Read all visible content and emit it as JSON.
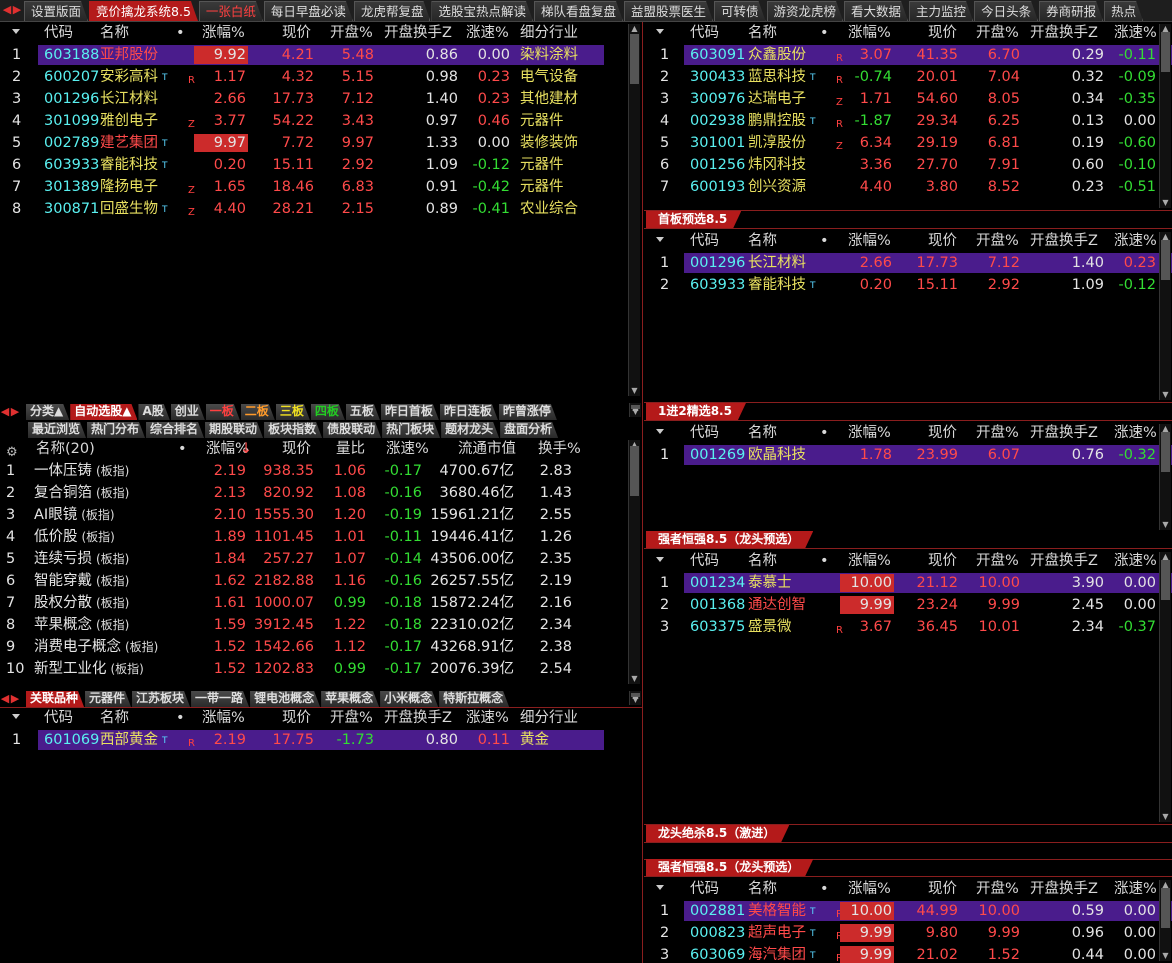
{
  "top_tabs": [
    "设置版面",
    "竞价擒龙系统8.5",
    "一张白纸",
    "每日早盘必读",
    "龙虎帮复盘",
    "选股宝热点解读",
    "梯队看盘复盘",
    "益盟股票医生",
    "可转债",
    "游资龙虎榜",
    "看大数据",
    "主力监控",
    "今日头条",
    "券商研报",
    "热点"
  ],
  "nav_arrows": [
    "◀",
    "▶"
  ],
  "stock_headers": [
    "代码",
    "名称",
    "•",
    "涨幅%",
    "现价",
    "开盘%",
    "开盘换手Z",
    "涨速%",
    "细分行业"
  ],
  "short_headers": [
    "代码",
    "名称",
    "•",
    "涨幅%",
    "现价",
    "开盘%",
    "开盘换手Z",
    "涨速%"
  ],
  "panel1": {
    "rows": [
      {
        "n": "1",
        "code": "603188",
        "name": "亚邦股份",
        "t": "",
        "b": "",
        "chg": "9.92",
        "price": "4.21",
        "open": "5.48",
        "turn": "0.86",
        "spd": "0.00",
        "ind": "染料涂料",
        "sel": true,
        "hl": true,
        "namecolor": "r"
      },
      {
        "n": "2",
        "code": "600207",
        "name": "安彩高科",
        "t": "T",
        "b": "R",
        "chg": "1.17",
        "price": "4.32",
        "open": "5.15",
        "turn": "0.98",
        "spd": "0.23",
        "ind": "电气设备"
      },
      {
        "n": "3",
        "code": "001296",
        "name": "长江材料",
        "t": "",
        "b": "",
        "chg": "2.66",
        "price": "17.73",
        "open": "7.12",
        "turn": "1.40",
        "spd": "0.23",
        "ind": "其他建材"
      },
      {
        "n": "4",
        "code": "301099",
        "name": "雅创电子",
        "t": "",
        "b": "Z",
        "chg": "3.77",
        "price": "54.22",
        "open": "3.43",
        "turn": "0.97",
        "spd": "0.46",
        "ind": "元器件"
      },
      {
        "n": "5",
        "code": "002789",
        "name": "建艺集团",
        "t": "T",
        "b": "",
        "chg": "9.97",
        "price": "7.72",
        "open": "9.97",
        "turn": "1.33",
        "spd": "0.00",
        "ind": "装修装饰",
        "hl": true,
        "namecolor": "r"
      },
      {
        "n": "6",
        "code": "603933",
        "name": "睿能科技",
        "t": "T",
        "b": "",
        "chg": "0.20",
        "price": "15.11",
        "open": "2.92",
        "turn": "1.09",
        "spd": "-0.12",
        "ind": "元器件"
      },
      {
        "n": "7",
        "code": "301389",
        "name": "隆扬电子",
        "t": "",
        "b": "Z",
        "chg": "1.65",
        "price": "18.46",
        "open": "6.83",
        "turn": "0.91",
        "spd": "-0.42",
        "ind": "元器件"
      },
      {
        "n": "8",
        "code": "300871",
        "name": "回盛生物",
        "t": "T",
        "b": "Z",
        "chg": "4.40",
        "price": "28.21",
        "open": "2.15",
        "turn": "0.89",
        "spd": "-0.41",
        "ind": "农业综合"
      }
    ]
  },
  "mid_tabs1": [
    "分类▲",
    "自动选股▲",
    "A股",
    "创业",
    "一板",
    "二板",
    "三板",
    "四板",
    "五板",
    "昨日首板",
    "昨日连板",
    "昨曾涨停"
  ],
  "mid_tabs2": [
    "最近浏览",
    "热门分布",
    "综合排名",
    "期股联动",
    "板块指数",
    "债股联动",
    "热门板块",
    "题材龙头",
    "盘面分析"
  ],
  "sector_headers": [
    "名称(20)",
    "•",
    "涨幅%",
    "现价",
    "量比",
    "涨速%",
    "流通市值",
    "换手%"
  ],
  "sector_sort_arrow": "↓",
  "sectors": [
    {
      "n": "1",
      "name": "一体压铸",
      "tag": "(板指)",
      "chg": "2.19",
      "price": "938.35",
      "vr": "1.06",
      "spd": "-0.17",
      "cap": "4700.67亿",
      "turn": "2.83"
    },
    {
      "n": "2",
      "name": "复合铜箔",
      "tag": "(板指)",
      "chg": "2.13",
      "price": "820.92",
      "vr": "1.08",
      "spd": "-0.16",
      "cap": "3680.46亿",
      "turn": "1.43"
    },
    {
      "n": "3",
      "name": "AI眼镜",
      "tag": "(板指)",
      "chg": "2.10",
      "price": "1555.30",
      "vr": "1.20",
      "spd": "-0.19",
      "cap": "15961.21亿",
      "turn": "2.55"
    },
    {
      "n": "4",
      "name": "低价股",
      "tag": "(板指)",
      "chg": "1.89",
      "price": "1101.45",
      "vr": "1.01",
      "spd": "-0.11",
      "cap": "19446.41亿",
      "turn": "1.26"
    },
    {
      "n": "5",
      "name": "连续亏损",
      "tag": "(板指)",
      "chg": "1.84",
      "price": "257.27",
      "vr": "1.07",
      "spd": "-0.14",
      "cap": "43506.00亿",
      "turn": "2.35"
    },
    {
      "n": "6",
      "name": "智能穿戴",
      "tag": "(板指)",
      "chg": "1.62",
      "price": "2182.88",
      "vr": "1.16",
      "spd": "-0.16",
      "cap": "26257.55亿",
      "turn": "2.19"
    },
    {
      "n": "7",
      "name": "股权分散",
      "tag": "(板指)",
      "chg": "1.61",
      "price": "1000.07",
      "vr": "0.99",
      "spd": "-0.18",
      "cap": "15872.24亿",
      "turn": "2.16"
    },
    {
      "n": "8",
      "name": "苹果概念",
      "tag": "(板指)",
      "chg": "1.59",
      "price": "3912.45",
      "vr": "1.22",
      "spd": "-0.18",
      "cap": "22310.02亿",
      "turn": "2.34"
    },
    {
      "n": "9",
      "name": "消费电子概念",
      "tag": "(板指)",
      "chg": "1.52",
      "price": "1542.66",
      "vr": "1.12",
      "spd": "-0.17",
      "cap": "43268.91亿",
      "turn": "2.38"
    },
    {
      "n": "10",
      "name": "新型工业化",
      "tag": "(板指)",
      "chg": "1.52",
      "price": "1202.83",
      "vr": "0.99",
      "spd": "-0.17",
      "cap": "20076.39亿",
      "turn": "2.54"
    }
  ],
  "bot_tabs": [
    "关联品种",
    "元器件",
    "江苏板块",
    "一带一路",
    "锂电池概念",
    "苹果概念",
    "小米概念",
    "特斯拉概念"
  ],
  "panel_related": {
    "rows": [
      {
        "n": "1",
        "code": "601069",
        "name": "西部黄金",
        "t": "T",
        "b": "R",
        "chg": "2.19",
        "price": "17.75",
        "open": "-1.73",
        "turn": "0.80",
        "spd": "0.11",
        "ind": "黄金",
        "sel": true
      }
    ]
  },
  "panel_r1": {
    "rows": [
      {
        "n": "1",
        "code": "603091",
        "name": "众鑫股份",
        "t": "",
        "b": "R",
        "chg": "3.07",
        "price": "41.35",
        "open": "6.70",
        "turn": "0.29",
        "spd": "-0.11",
        "sel": true
      },
      {
        "n": "2",
        "code": "300433",
        "name": "蓝思科技",
        "t": "T",
        "b": "R",
        "chg": "-0.74",
        "price": "20.01",
        "open": "7.04",
        "turn": "0.32",
        "spd": "-0.09"
      },
      {
        "n": "3",
        "code": "300976",
        "name": "达瑞电子",
        "t": "",
        "b": "Z",
        "chg": "1.71",
        "price": "54.60",
        "open": "8.05",
        "turn": "0.34",
        "spd": "-0.35"
      },
      {
        "n": "4",
        "code": "002938",
        "name": "鹏鼎控股",
        "t": "T",
        "b": "R",
        "chg": "-1.87",
        "price": "29.34",
        "open": "6.25",
        "turn": "0.13",
        "spd": "0.00"
      },
      {
        "n": "5",
        "code": "301001",
        "name": "凯淳股份",
        "t": "",
        "b": "Z",
        "chg": "6.34",
        "price": "29.19",
        "open": "6.81",
        "turn": "0.19",
        "spd": "-0.60"
      },
      {
        "n": "6",
        "code": "001256",
        "name": "炜冈科技",
        "t": "",
        "b": "",
        "chg": "3.36",
        "price": "27.70",
        "open": "7.91",
        "turn": "0.60",
        "spd": "-0.10"
      },
      {
        "n": "7",
        "code": "600193",
        "name": "创兴资源",
        "t": "",
        "b": "",
        "chg": "4.40",
        "price": "3.80",
        "open": "8.52",
        "turn": "0.23",
        "spd": "-0.51"
      }
    ]
  },
  "panel_r2": {
    "title": "首板预选8.5",
    "rows": [
      {
        "n": "1",
        "code": "001296",
        "name": "长江材料",
        "t": "",
        "b": "",
        "chg": "2.66",
        "price": "17.73",
        "open": "7.12",
        "turn": "1.40",
        "spd": "0.23",
        "sel": true
      },
      {
        "n": "2",
        "code": "603933",
        "name": "睿能科技",
        "t": "T",
        "b": "",
        "chg": "0.20",
        "price": "15.11",
        "open": "2.92",
        "turn": "1.09",
        "spd": "-0.12"
      }
    ]
  },
  "panel_r3": {
    "title": "1进2精选8.5",
    "rows": [
      {
        "n": "1",
        "code": "001269",
        "name": "欧晶科技",
        "t": "",
        "b": "",
        "chg": "1.78",
        "price": "23.99",
        "open": "6.07",
        "turn": "0.76",
        "spd": "-0.32",
        "sel": true
      }
    ]
  },
  "panel_r4": {
    "title": "强者恒强8.5（龙头预选）",
    "rows": [
      {
        "n": "1",
        "code": "001234",
        "name": "泰慕士",
        "t": "",
        "b": "",
        "chg": "10.00",
        "price": "21.12",
        "open": "10.00",
        "turn": "3.90",
        "spd": "0.00",
        "sel": true,
        "hl": true,
        "namecolor": "y"
      },
      {
        "n": "2",
        "code": "001368",
        "name": "通达创智",
        "t": "",
        "b": "",
        "chg": "9.99",
        "price": "23.24",
        "open": "9.99",
        "turn": "2.45",
        "spd": "0.00",
        "hl": true,
        "namecolor": "r"
      },
      {
        "n": "3",
        "code": "603375",
        "name": "盛景微",
        "t": "",
        "b": "R",
        "chg": "3.67",
        "price": "36.45",
        "open": "10.01",
        "turn": "2.34",
        "spd": "-0.37"
      }
    ]
  },
  "panel_r5": {
    "title": "龙头绝杀8.5（激进）"
  },
  "panel_r6": {
    "title": "强者恒强8.5（龙头预选）",
    "rows": [
      {
        "n": "1",
        "code": "002881",
        "name": "美格智能",
        "t": "T",
        "b": "R",
        "chg": "10.00",
        "price": "44.99",
        "open": "10.00",
        "turn": "0.59",
        "spd": "0.00",
        "sel": true,
        "hl": true,
        "namecolor": "r"
      },
      {
        "n": "2",
        "code": "000823",
        "name": "超声电子",
        "t": "T",
        "b": "R",
        "chg": "9.99",
        "price": "9.80",
        "open": "9.99",
        "turn": "0.96",
        "spd": "0.00",
        "hl": true,
        "namecolor": "r"
      },
      {
        "n": "3",
        "code": "603069",
        "name": "海汽集团",
        "t": "T",
        "b": "R",
        "chg": "9.99",
        "price": "21.02",
        "open": "1.52",
        "turn": "0.44",
        "spd": "0.00",
        "hl": true,
        "namecolor": "r"
      }
    ]
  },
  "colors": {
    "accent": "#b41a1a",
    "selection": "#4a1c8c",
    "up": "#ff4a4a",
    "down": "#33dd33",
    "code": "#5af0f0",
    "title": "#e8e060"
  }
}
